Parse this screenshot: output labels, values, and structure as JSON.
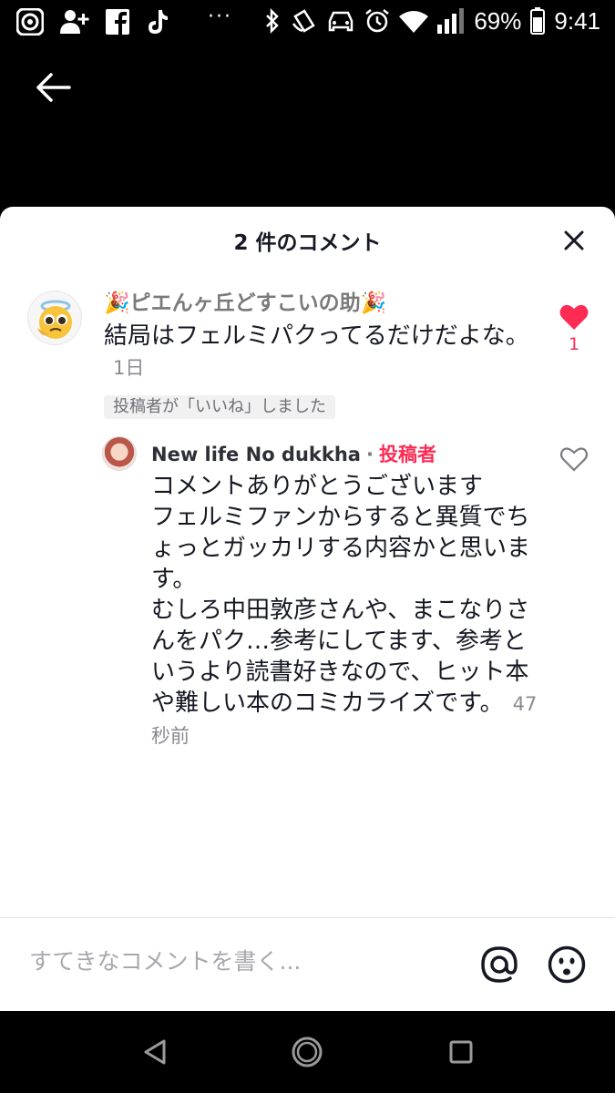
{
  "status_bar": {
    "overflow": "···",
    "battery": "69%",
    "time": "9:41"
  },
  "sheet": {
    "title": "2 件のコメント"
  },
  "comments": [
    {
      "author": "🎉ピエんヶ丘どすこいの助🎉",
      "text": "結局はフェルミパクってるだけだよな。",
      "time": "1日",
      "badge": "投稿者が「いいね」しました",
      "likes": "1",
      "liked": true
    },
    {
      "author": "New life No dukkha",
      "separator": "·",
      "author_tag": "投稿者",
      "text": "コメントありがとうございます\nフェルミファンからすると異質でちょっとガッカリする内容かと思います。\nむしろ中田敦彦さんや、まこなりさんをパク…参考にしてます、参考というより読書好きなので、ヒット本や難しい本のコミカライズです。",
      "time": "47秒前",
      "liked": false
    }
  ],
  "input": {
    "placeholder": "すてきなコメントを書く..."
  },
  "colors": {
    "accent": "#fe2c55",
    "text": "#161823",
    "muted": "#8a8b91"
  },
  "icons": [
    "back-arrow-icon",
    "close-icon",
    "heart-filled-icon",
    "heart-outline-icon",
    "at-icon",
    "emoji-icon",
    "nav-back-icon",
    "nav-home-icon",
    "nav-recents-icon"
  ]
}
